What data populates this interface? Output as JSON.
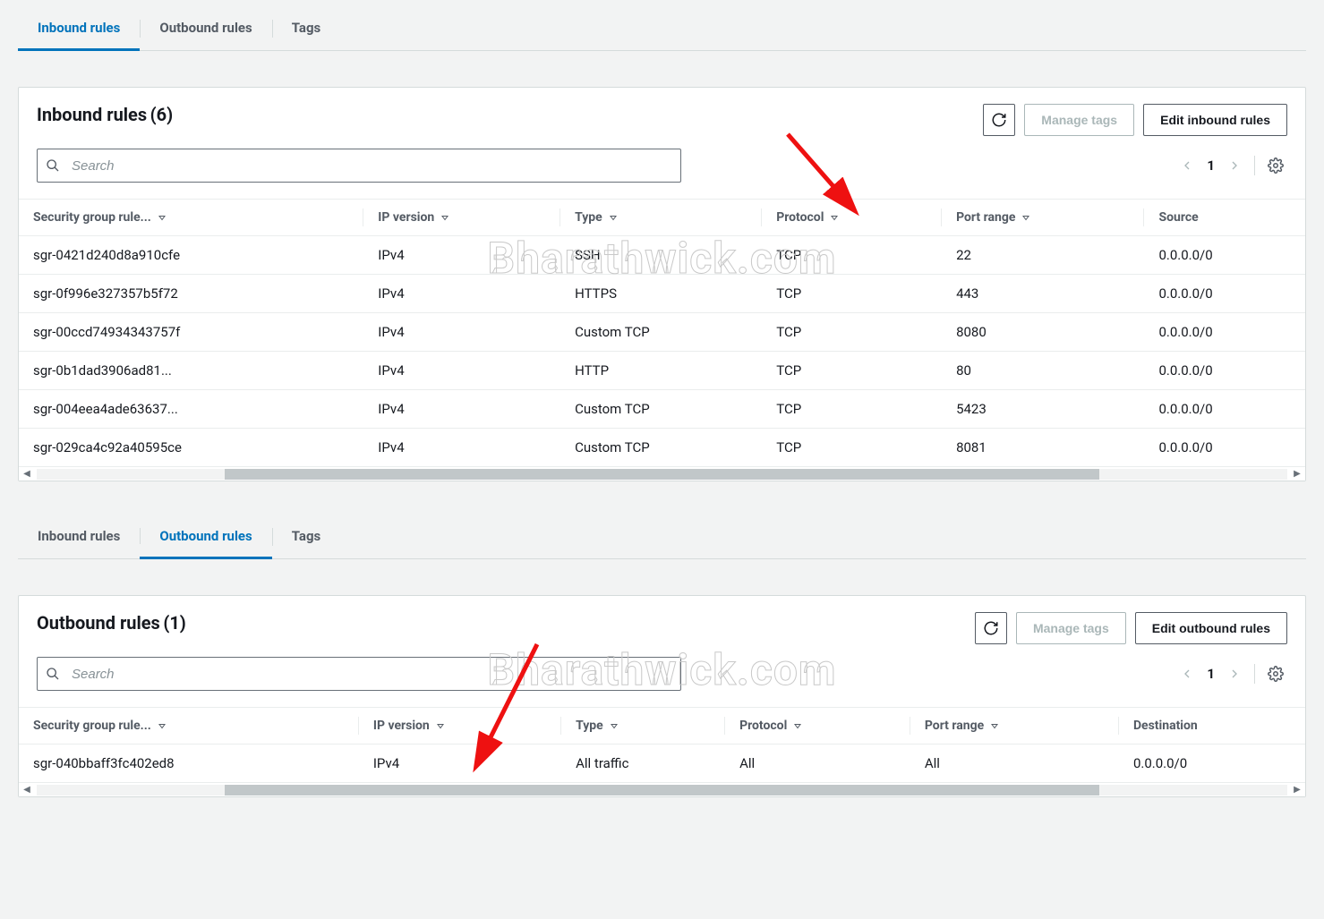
{
  "watermark": "Bharathwick.com",
  "sections": [
    {
      "tabs": [
        "Inbound rules",
        "Outbound rules",
        "Tags"
      ],
      "active_tab_index": 0,
      "title": "Inbound rules",
      "count": "(6)",
      "buttons": {
        "refresh": "↻",
        "manage_tags": "Manage tags",
        "edit": "Edit inbound rules"
      },
      "search_placeholder": "Search",
      "page": "1",
      "columns": [
        "Security group rule...",
        "IP version",
        "Type",
        "Protocol",
        "Port range",
        "Source"
      ],
      "rows": [
        [
          "sgr-0421d240d8a910cfe",
          "IPv4",
          "SSH",
          "TCP",
          "22",
          "0.0.0.0/0"
        ],
        [
          "sgr-0f996e327357b5f72",
          "IPv4",
          "HTTPS",
          "TCP",
          "443",
          "0.0.0.0/0"
        ],
        [
          "sgr-00ccd74934343757f",
          "IPv4",
          "Custom TCP",
          "TCP",
          "8080",
          "0.0.0.0/0"
        ],
        [
          "sgr-0b1dad3906ad81...",
          "IPv4",
          "HTTP",
          "TCP",
          "80",
          "0.0.0.0/0"
        ],
        [
          "sgr-004eea4ade63637...",
          "IPv4",
          "Custom TCP",
          "TCP",
          "5423",
          "0.0.0.0/0"
        ],
        [
          "sgr-029ca4c92a40595ce",
          "IPv4",
          "Custom TCP",
          "TCP",
          "8081",
          "0.0.0.0/0"
        ]
      ]
    },
    {
      "tabs": [
        "Inbound rules",
        "Outbound rules",
        "Tags"
      ],
      "active_tab_index": 1,
      "title": "Outbound rules",
      "count": "(1)",
      "buttons": {
        "refresh": "↻",
        "manage_tags": "Manage tags",
        "edit": "Edit outbound rules"
      },
      "search_placeholder": "Search",
      "page": "1",
      "columns": [
        "Security group rule...",
        "IP version",
        "Type",
        "Protocol",
        "Port range",
        "Destination"
      ],
      "rows": [
        [
          "sgr-040bbaff3fc402ed8",
          "IPv4",
          "All traffic",
          "All",
          "All",
          "0.0.0.0/0"
        ]
      ]
    }
  ]
}
